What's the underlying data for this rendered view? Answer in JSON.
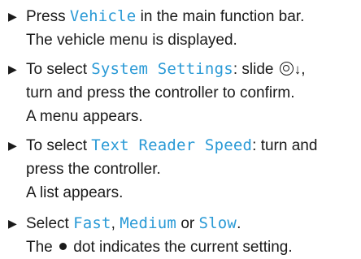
{
  "steps": [
    {
      "parts": {
        "a": "Press ",
        "b": "Vehicle",
        "c": " in the main function bar."
      },
      "result": "The vehicle menu is displayed."
    },
    {
      "parts": {
        "a": "To select ",
        "b": "System Settings",
        "c": ": slide "
      },
      "arrow": "↓",
      "cont": ",",
      "line2": "turn and press the controller to confirm.",
      "result": "A menu appears."
    },
    {
      "parts": {
        "a": "To select ",
        "b": "Text Reader Speed",
        "c": ": turn and"
      },
      "line2": "press the controller.",
      "result": "A list appears."
    },
    {
      "parts": {
        "a": "Select ",
        "b": "Fast",
        "c": ", ",
        "d": "Medium",
        "e": " or ",
        "f": "Slow",
        "g": "."
      },
      "result_a": "The ",
      "result_b": " dot indicates the current setting."
    }
  ],
  "bullet_glyph": "▶",
  "icons": {
    "controller": "controller-icon",
    "bullet": "play-triangle-icon",
    "dot": "filled-dot-icon"
  },
  "colors": {
    "ui_text": "#2a9ad6",
    "body_text": "#1a1a1a"
  }
}
